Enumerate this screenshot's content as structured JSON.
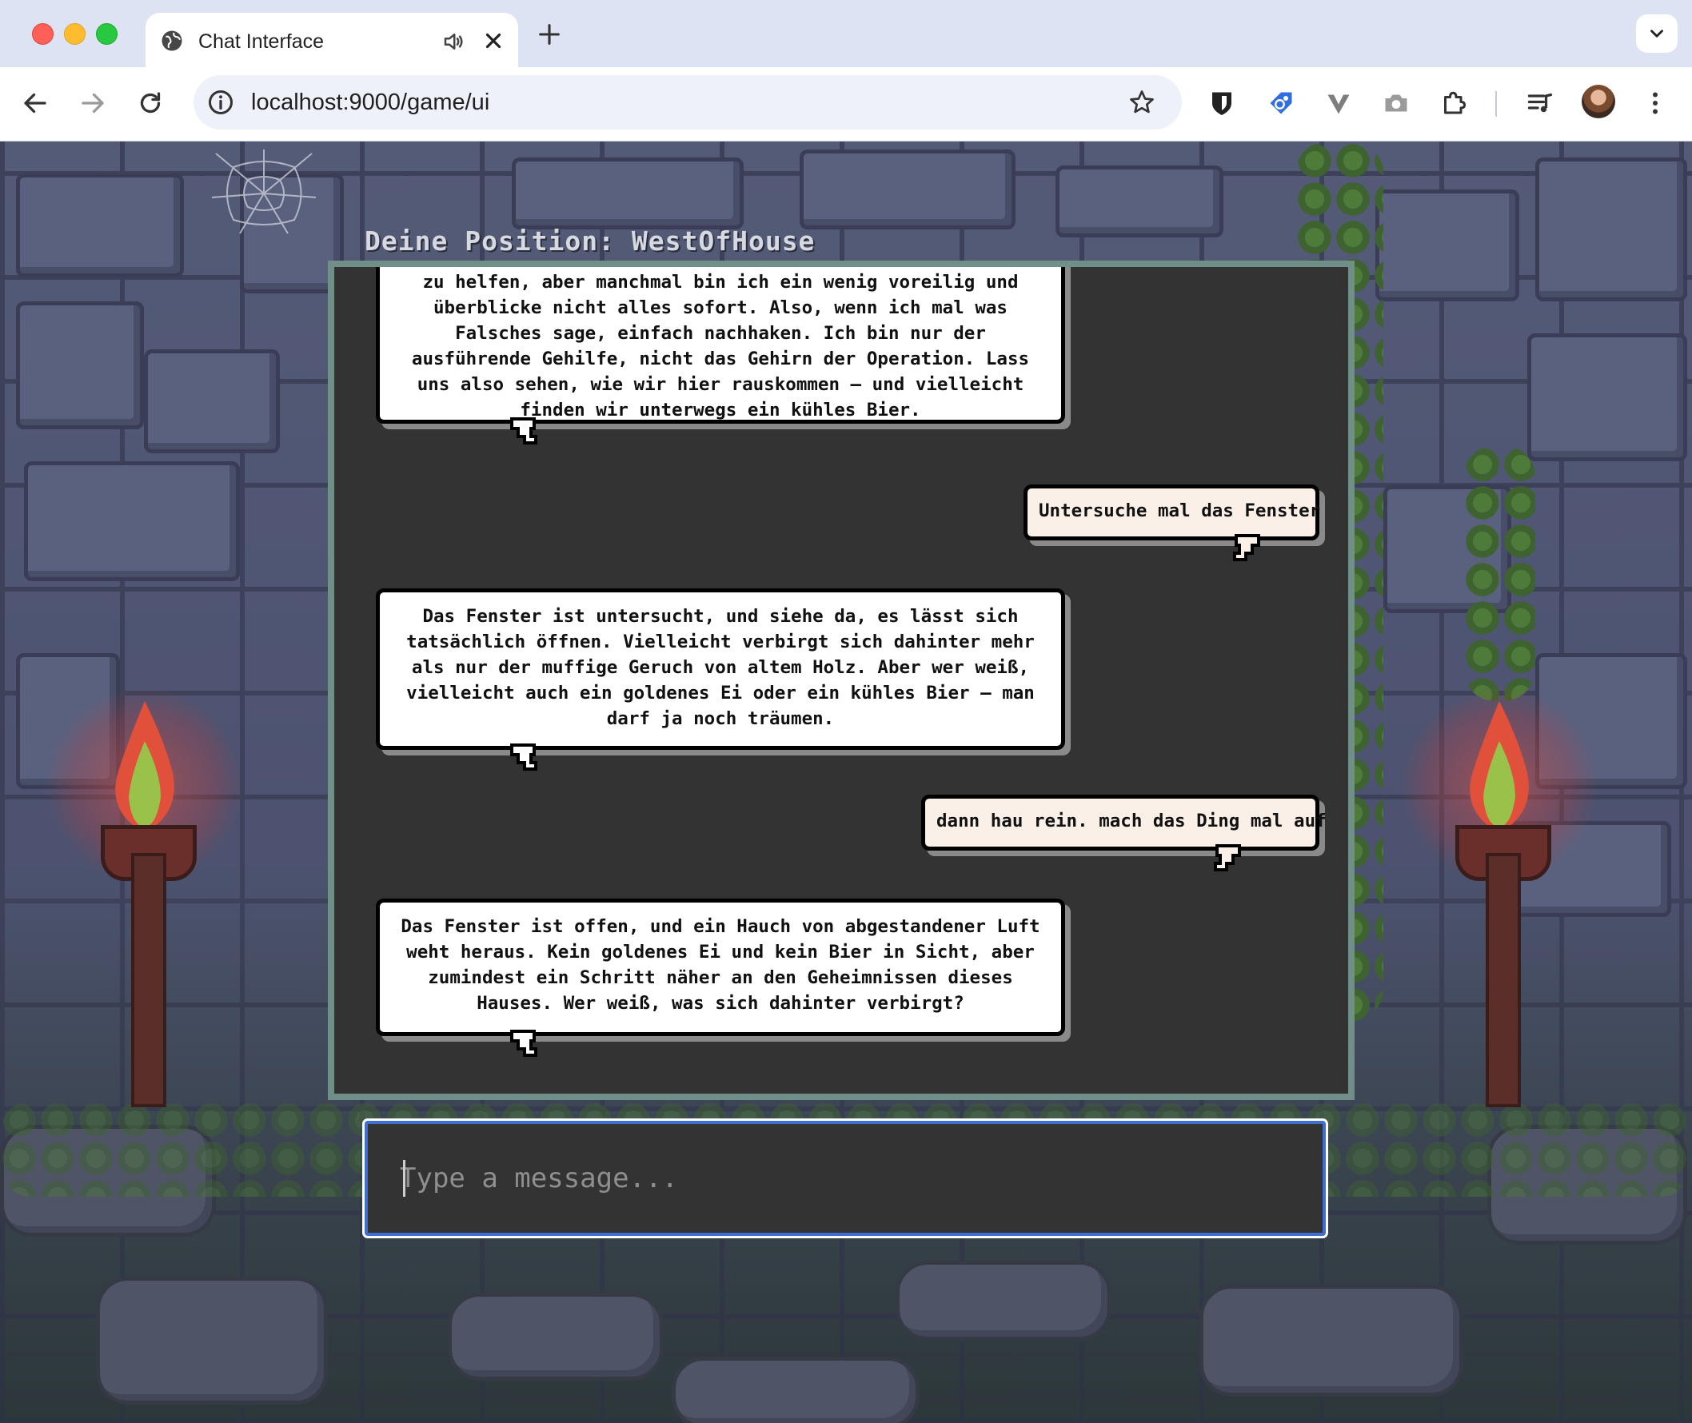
{
  "browser": {
    "tab_title": "Chat Interface",
    "url": "localhost:9000/game/ui"
  },
  "game": {
    "position_label": "Deine Position: WestOfHouse"
  },
  "messages": [
    {
      "role": "assistant",
      "text": "zu helfen, aber manchmal bin ich ein wenig voreilig und überblicke nicht alles sofort. Also, wenn ich mal was Falsches sage, einfach nachhaken. Ich bin nur der ausführende Gehilfe, nicht das Gehirn der Operation. Lass uns also sehen, wie wir hier rauskommen – und vielleicht finden wir unterwegs ein kühles Bier."
    },
    {
      "role": "user",
      "text": "Untersuche mal das Fenster"
    },
    {
      "role": "assistant",
      "text": "Das Fenster ist untersucht, und siehe da, es lässt sich tatsächlich öffnen. Vielleicht verbirgt sich dahinter mehr als nur der muffige Geruch von altem Holz. Aber wer weiß, vielleicht auch ein goldenes Ei oder ein kühles Bier – man darf ja noch träumen."
    },
    {
      "role": "user",
      "text": "dann hau rein. mach das Ding mal auf"
    },
    {
      "role": "assistant",
      "text": "Das Fenster ist offen, und ein Hauch von abgestandener Luft weht heraus. Kein goldenes Ei und kein Bier in Sicht, aber zumindest ein Schritt näher an den Geheimnissen dieses Hauses. Wer weiß, was sich dahinter verbirgt?"
    }
  ],
  "input": {
    "placeholder": "Type a message...",
    "value": ""
  },
  "colors": {
    "chat_border": "#6f8f88",
    "chat_bg": "#333333",
    "input_focus": "#3f6fd1",
    "user_bubble": "#fbf0e8",
    "assistant_bubble": "#ffffff"
  },
  "icons": {
    "tab": [
      "globe-icon",
      "speaker-icon",
      "close-icon",
      "plus-icon",
      "chevron-down-icon"
    ],
    "toolbar": [
      "back-arrow-icon",
      "forward-arrow-icon",
      "reload-icon",
      "site-info-icon",
      "bookmark-star-icon",
      "bitwarden-icon",
      "tag-extension-icon",
      "vimeo-extension-icon",
      "camera-extension-icon",
      "puzzle-extensions-icon",
      "media-queue-icon",
      "profile-avatar",
      "kebab-menu-icon"
    ]
  }
}
